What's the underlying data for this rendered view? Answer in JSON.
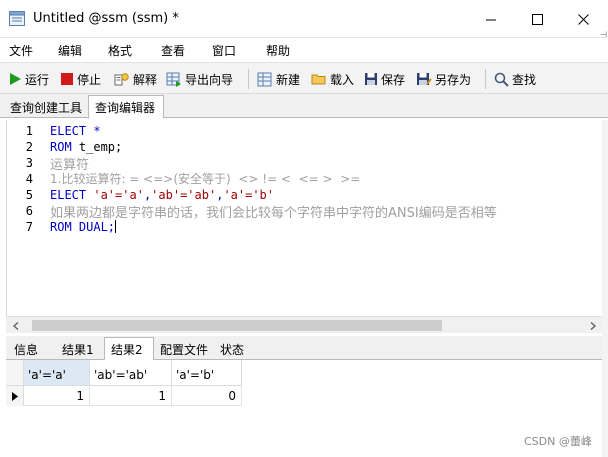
{
  "window": {
    "title": "Untitled @ssm (ssm) *"
  },
  "menu": [
    {
      "label": "文件"
    },
    {
      "label": "编辑"
    },
    {
      "label": "格式"
    },
    {
      "label": "查看"
    },
    {
      "label": "窗口"
    },
    {
      "label": "帮助"
    }
  ],
  "toolbar": {
    "run": "运行",
    "stop": "停止",
    "explain": "解释",
    "export_wizard": "导出向导",
    "new": "新建",
    "load": "载入",
    "save": "保存",
    "save_as": "另存为",
    "find": "查找"
  },
  "tabs": {
    "query_builder": "查询创建工具",
    "query_editor": "查询编辑器"
  },
  "editor": {
    "line_numbers": [
      "1",
      "2",
      "3",
      "4",
      "5",
      "6",
      "7"
    ],
    "line1_kw": "ELECT *",
    "line2_kw": "ROM",
    "line2_rest": " t_emp;",
    "line3": "运算符",
    "line4": "1.比较运算符: = <=>(安全等于)  <> != <  <= >  >=",
    "line5_kw": "ELECT",
    "line5_s1": "'a'='a'",
    "line5_s2": "'ab'='ab'",
    "line5_s3": "'a'='b'",
    "line6": "如果两边都是字符串的话，我们会比较每个字符串中字符的ANSI编码是否相等",
    "line7_kw": "ROM DUAL;"
  },
  "result_tabs": {
    "info": "信息",
    "result1": "结果1",
    "result2": "结果2",
    "profile": "配置文件",
    "status": "状态"
  },
  "grid": {
    "headers": [
      "'a'='a'",
      "'ab'='ab'",
      "'a'='b'"
    ],
    "row1": [
      "1",
      "1",
      "0"
    ]
  },
  "watermark": "CSDN @蕾峰",
  "colors": {
    "keyword": "#0000c8",
    "string": "#9b0000",
    "comment": "#a0a0a0"
  }
}
